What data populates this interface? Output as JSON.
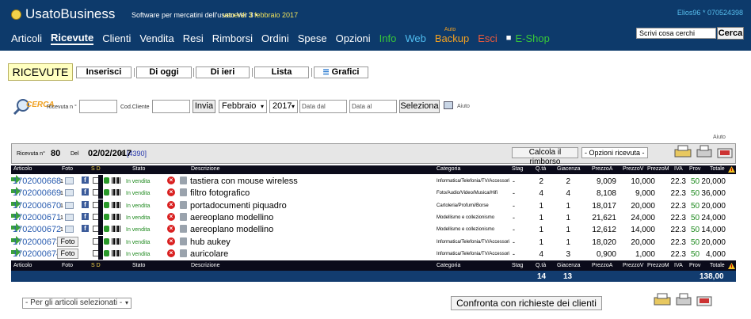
{
  "header": {
    "brand": "UsatoBusiness",
    "tagline": "Software per mercatini dell'usato Ver 3 •",
    "date": "venerdì 3 febbraio 2017",
    "user": "Elios96 * 070524398",
    "search_placeholder": "Scrivi cosa cerchi",
    "search_button": "Cerca",
    "nav": [
      "Articoli",
      "Ricevute",
      "Clienti",
      "Vendita",
      "Resi",
      "Rimborsi",
      "Ordini",
      "Spese",
      "Opzioni",
      "Info",
      "Web"
    ],
    "backup_small": "Auto",
    "backup": "Backup",
    "esci": "Esci",
    "eshop": "E-Shop"
  },
  "toolbar": {
    "title": "RICEVUTE",
    "buttons": [
      "Inserisci",
      "Di oggi",
      "Di ieri",
      "Lista",
      "Grafici"
    ]
  },
  "filter": {
    "cerca_logo": "CERCA",
    "ricevuta_label": "Ricevuta n °",
    "cliente_label": "Cod.Cliente",
    "invia": "Invia",
    "month": "Febbraio",
    "year": "2017",
    "data_dal": "Data dal",
    "data_al": "Data al",
    "seleziona": "Seleziona",
    "aiuto": "Aiuto"
  },
  "receipt": {
    "aiuto": "Aiuto",
    "label_n": "Ricevuta n°",
    "number": "80",
    "label_del": "Del",
    "date": "02/02/2017",
    "label_di": "di",
    "client": "[4390]",
    "calc_button": "Calcola il rimborso",
    "options": "- Opzioni ricevuta -"
  },
  "columns": {
    "articolo": "Articolo",
    "foto": "Foto",
    "sd": "S D",
    "stato": "Stato",
    "descrizione": "Descrizione",
    "categoria": "Categoria",
    "stag": "Stag",
    "qta": "Q.tà",
    "giacenza": "Giacenza",
    "prezzoa": "PrezzoA",
    "prezzov": "PrezzoV",
    "prezzom": "PrezzoM",
    "iva": "IVA",
    "prov": "Prov",
    "totale": "Totale"
  },
  "rows": [
    {
      "code": "1702000668",
      "foto_count": "1",
      "has_image": true,
      "stato": "In vendita",
      "desc": "tastiera con mouse wireless",
      "cat": "Informatica/Telefonia/TV/Accessori",
      "stag": "-",
      "qta": "2",
      "giac": "2",
      "pa": "9,009",
      "pv": "10,000",
      "iva": "22.3",
      "prov": "50",
      "tot": "20,000"
    },
    {
      "code": "1702000669",
      "foto_count": "1",
      "has_image": true,
      "stato": "In vendita",
      "desc": "filtro fotografico",
      "cat": "Foto/Audio/Video/Musica/Hifi",
      "stag": "-",
      "qta": "4",
      "giac": "4",
      "pa": "8,108",
      "pv": "9,000",
      "iva": "22.3",
      "prov": "50",
      "tot": "36,000"
    },
    {
      "code": "1702000670",
      "foto_count": "1",
      "has_image": true,
      "stato": "In vendita",
      "desc": "portadocumenti piquadro",
      "cat": "Cartoleria/Profumi/Borse",
      "stag": "-",
      "qta": "1",
      "giac": "1",
      "pa": "18,017",
      "pv": "20,000",
      "iva": "22.3",
      "prov": "50",
      "tot": "20,000"
    },
    {
      "code": "1702000671",
      "foto_count": "1",
      "has_image": true,
      "stato": "In vendita",
      "desc": "aereoplano modellino",
      "cat": "Modellismo e collezionismo",
      "stag": "-",
      "qta": "1",
      "giac": "1",
      "pa": "21,621",
      "pv": "24,000",
      "iva": "22.3",
      "prov": "50",
      "tot": "24,000"
    },
    {
      "code": "1702000672",
      "foto_count": "1",
      "has_image": true,
      "stato": "In vendita",
      "desc": "aereoplano modellino",
      "cat": "Modellismo e collezionismo",
      "stag": "-",
      "qta": "1",
      "giac": "1",
      "pa": "12,612",
      "pv": "14,000",
      "iva": "22.3",
      "prov": "50",
      "tot": "14,000"
    },
    {
      "code": "1702000673",
      "foto_count": "",
      "has_image": false,
      "foto_btn": "Foto",
      "stato": "In vendita",
      "desc": "hub aukey",
      "cat": "Informatica/Telefonia/TV/Accessori",
      "stag": "-",
      "qta": "1",
      "giac": "1",
      "pa": "18,020",
      "pv": "20,000",
      "iva": "22.3",
      "prov": "50",
      "tot": "20,000"
    },
    {
      "code": "1702000674",
      "foto_count": "",
      "has_image": false,
      "foto_btn": "Foto",
      "stato": "In vendita",
      "desc": "auricolare",
      "cat": "Informatica/Telefonia/TV/Accessori",
      "stag": "-",
      "qta": "4",
      "giac": "3",
      "pa": "0,900",
      "pv": "1,000",
      "iva": "22.3",
      "prov": "50",
      "tot": "4,000"
    }
  ],
  "totals": {
    "qta": "14",
    "giac": "13",
    "totale": "138,00"
  },
  "bottom": {
    "bulk_select": "- Per gli articoli selezionati -",
    "confronta": "Confronta con richieste dei clienti"
  },
  "colors": {
    "header_bg": "#0d3a6b",
    "link": "#2a5db0",
    "green": "#1e8a1e",
    "accent_yellow": "#ffffc0"
  }
}
